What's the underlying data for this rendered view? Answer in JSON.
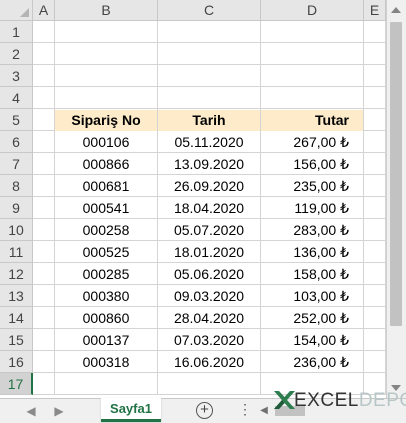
{
  "columns": [
    "A",
    "B",
    "C",
    "D",
    "E"
  ],
  "rows": [
    "1",
    "2",
    "3",
    "4",
    "5",
    "6",
    "7",
    "8",
    "9",
    "10",
    "11",
    "12",
    "13",
    "14",
    "15",
    "16",
    "17"
  ],
  "table": {
    "headers": {
      "order_no": "Sipariş No",
      "date": "Tarih",
      "amount": "Tutar"
    },
    "records": [
      {
        "order_no": "000106",
        "date": "05.11.2020",
        "amount": "267,00 ₺"
      },
      {
        "order_no": "000866",
        "date": "13.09.2020",
        "amount": "156,00 ₺"
      },
      {
        "order_no": "000681",
        "date": "26.09.2020",
        "amount": "235,00 ₺"
      },
      {
        "order_no": "000541",
        "date": "18.04.2020",
        "amount": "119,00 ₺"
      },
      {
        "order_no": "000258",
        "date": "05.07.2020",
        "amount": "283,00 ₺"
      },
      {
        "order_no": "000525",
        "date": "18.01.2020",
        "amount": "136,00 ₺"
      },
      {
        "order_no": "000285",
        "date": "05.06.2020",
        "amount": "158,00 ₺"
      },
      {
        "order_no": "000380",
        "date": "09.03.2020",
        "amount": "103,00 ₺"
      },
      {
        "order_no": "000860",
        "date": "28.04.2020",
        "amount": "252,00 ₺"
      },
      {
        "order_no": "000137",
        "date": "07.03.2020",
        "amount": "154,00 ₺"
      },
      {
        "order_no": "000318",
        "date": "16.06.2020",
        "amount": "236,00 ₺"
      }
    ]
  },
  "sheet_tab": {
    "label": "Sayfa1"
  },
  "selected_row": "17",
  "logo": {
    "part1": "EXCEL",
    "part2": "DEPO"
  },
  "colors": {
    "accent": "#217346",
    "header_fill": "#fdebc9"
  },
  "icons": [
    "scroll-left-icon",
    "scroll-right-icon",
    "add-sheet-icon",
    "more-options-icon"
  ]
}
